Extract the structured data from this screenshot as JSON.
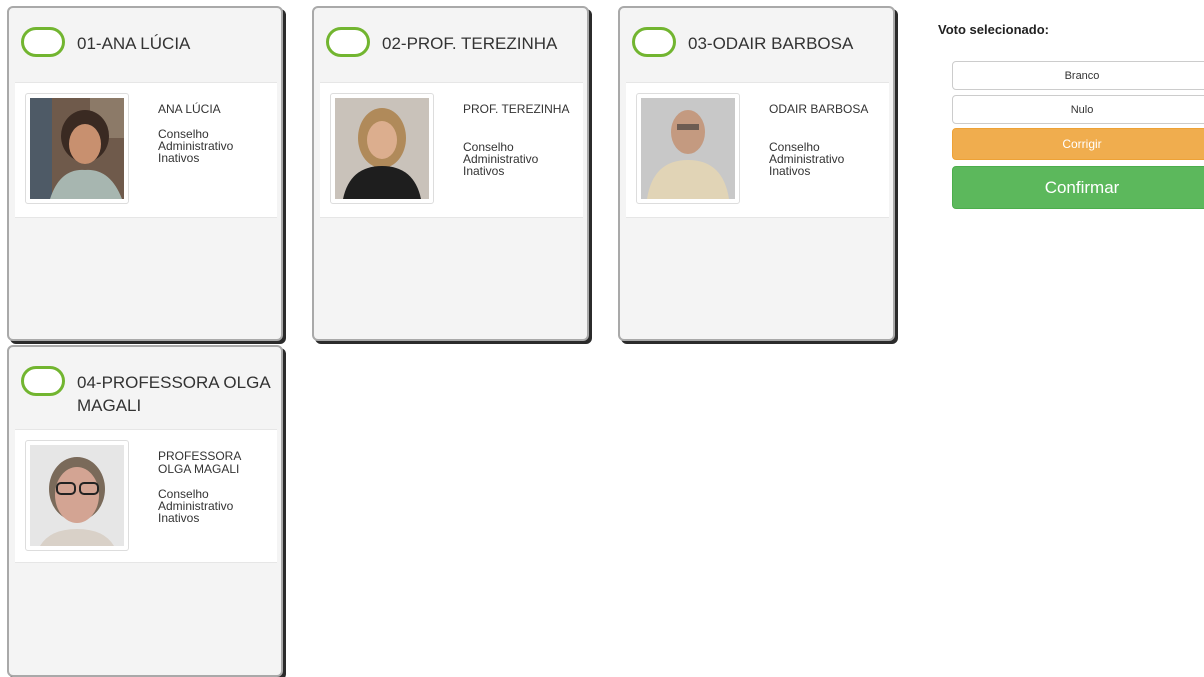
{
  "candidates": [
    {
      "title": "01-ANA LÚCIA",
      "name": "ANA LÚCIA",
      "group": [
        "Conselho",
        "Administrativo",
        "Inativos"
      ]
    },
    {
      "title": "02-PROF. TEREZINHA",
      "name": "PROF. TEREZINHA",
      "group": [
        "Conselho",
        "Administrativo",
        "Inativos"
      ]
    },
    {
      "title": "03-ODAIR BARBOSA",
      "name": "ODAIR BARBOSA",
      "group": [
        "Conselho",
        "Administrativo",
        "Inativos"
      ]
    },
    {
      "title": "04-PROFESSORA OLGA MAGALI",
      "name": "PROFESSORA OLGA MAGALI",
      "group": [
        "Conselho",
        "Administrativo",
        "Inativos"
      ]
    }
  ],
  "sidebar": {
    "title": "Voto selecionado:",
    "branco_label": "Branco",
    "nulo_label": "Nulo",
    "corrigir_label": "Corrigir",
    "confirmar_label": "Confirmar"
  },
  "colors": {
    "radio_border": "#72b530",
    "corrigir": "#f0ad4e",
    "confirmar": "#5cb85c"
  }
}
